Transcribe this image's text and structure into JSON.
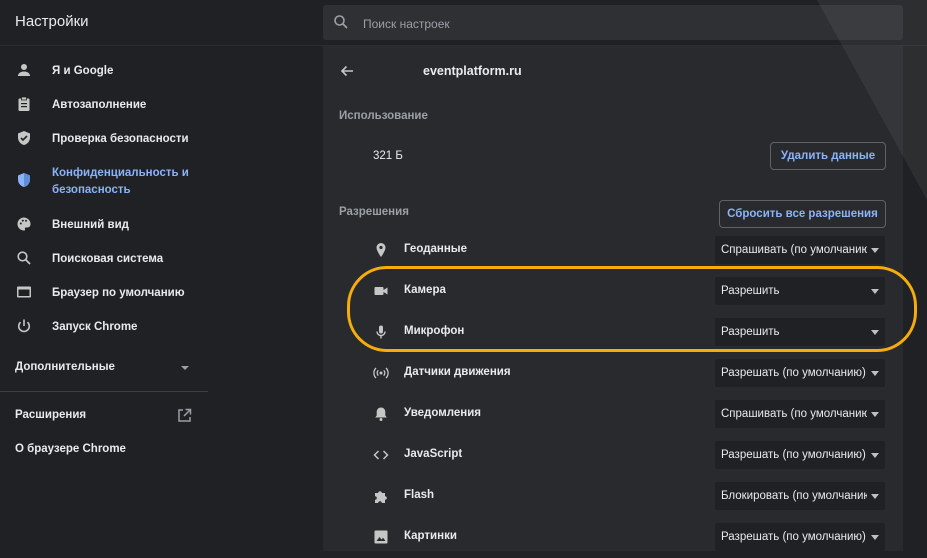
{
  "header": {
    "title": "Настройки",
    "search_placeholder": "Поиск настроек"
  },
  "sidebar": {
    "items": [
      {
        "label": "Я и Google",
        "icon": "person-icon"
      },
      {
        "label": "Автозаполнение",
        "icon": "clipboard-icon"
      },
      {
        "label": "Проверка безопасности",
        "icon": "shield-check-icon"
      },
      {
        "label": "Конфиденциальность и безопасность",
        "icon": "shield-icon",
        "active": true
      },
      {
        "label": "Внешний вид",
        "icon": "palette-icon"
      },
      {
        "label": "Поисковая система",
        "icon": "search-icon"
      },
      {
        "label": "Браузер по умолчанию",
        "icon": "browser-icon"
      },
      {
        "label": "Запуск Chrome",
        "icon": "power-icon"
      }
    ],
    "advanced": "Дополнительные",
    "extensions": "Расширения",
    "about": "О браузере Chrome"
  },
  "main": {
    "site": "eventplatform.ru",
    "usage": {
      "title": "Использование",
      "value": "321 Б",
      "clear_button": "Удалить данные"
    },
    "permissions": {
      "title": "Разрешения",
      "reset_button": "Сбросить все разрешения",
      "rows": [
        {
          "label": "Геоданные",
          "value": "Спрашивать (по умолчанию)",
          "icon": "location-icon"
        },
        {
          "label": "Камера",
          "value": "Разрешить",
          "icon": "camera-icon"
        },
        {
          "label": "Микрофон",
          "value": "Разрешить",
          "icon": "microphone-icon"
        },
        {
          "label": "Датчики движения",
          "value": "Разрешать (по умолчанию)",
          "icon": "sensors-icon"
        },
        {
          "label": "Уведомления",
          "value": "Спрашивать (по умолчанию)",
          "icon": "bell-icon"
        },
        {
          "label": "JavaScript",
          "value": "Разрешать (по умолчанию)",
          "icon": "code-icon"
        },
        {
          "label": "Flash",
          "value": "Блокировать (по умолчанию)",
          "icon": "puzzle-icon"
        },
        {
          "label": "Картинки",
          "value": "Разрешать (по умолчанию)",
          "icon": "image-icon"
        }
      ]
    }
  },
  "colors": {
    "accent": "#8ab4f8",
    "highlight": "#f4ad0c",
    "background": "#202124",
    "panel": "#292a2d"
  }
}
